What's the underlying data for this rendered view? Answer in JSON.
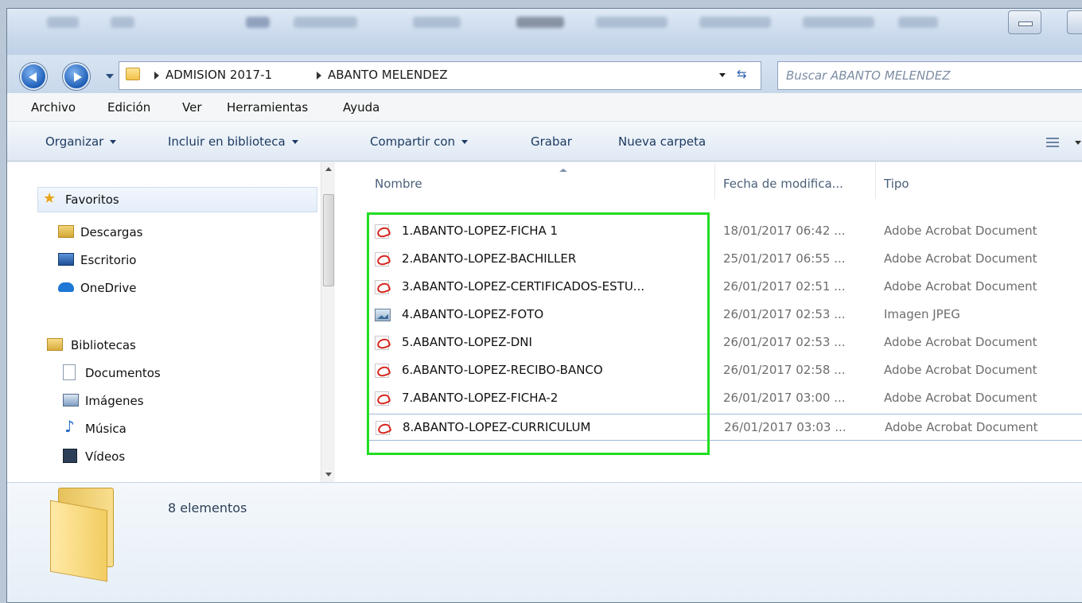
{
  "window": {
    "title_bar_controls": [
      "minimize-icon",
      "maximize-icon"
    ]
  },
  "address": {
    "crumbs": [
      "ADMISION 2017-1",
      "ABANTO MELENDEZ"
    ],
    "search_placeholder": "Buscar ABANTO MELENDEZ"
  },
  "menu": [
    "Archivo",
    "Edición",
    "Ver",
    "Herramientas",
    "Ayuda"
  ],
  "toolbar": {
    "organize": "Organizar",
    "include": "Incluir en biblioteca",
    "share": "Compartir con",
    "burn": "Grabar",
    "new_folder": "Nueva carpeta"
  },
  "sidebar": {
    "favorites": "Favoritos",
    "items": [
      {
        "label": "Descargas",
        "icon": "downloads-icon"
      },
      {
        "label": "Escritorio",
        "icon": "desktop-icon"
      },
      {
        "label": "OneDrive",
        "icon": "onedrive-icon"
      }
    ],
    "libraries": "Bibliotecas",
    "library_items": [
      {
        "label": "Documentos",
        "icon": "documents-icon"
      },
      {
        "label": "Imágenes",
        "icon": "pictures-icon"
      },
      {
        "label": "Música",
        "icon": "music-icon"
      },
      {
        "label": "Vídeos",
        "icon": "videos-icon"
      }
    ]
  },
  "columns": {
    "name": "Nombre",
    "date": "Fecha de modifica...",
    "type": "Tipo"
  },
  "files": [
    {
      "name": "1.ABANTO-LOPEZ-FICHA 1",
      "date": "18/01/2017 06:42 ...",
      "type": "Adobe Acrobat Document",
      "icon": "pdf-icon"
    },
    {
      "name": "2.ABANTO-LOPEZ-BACHILLER",
      "date": "25/01/2017 06:55 ...",
      "type": "Adobe Acrobat Document",
      "icon": "pdf-icon"
    },
    {
      "name": "3.ABANTO-LOPEZ-CERTIFICADOS-ESTU...",
      "date": "26/01/2017 02:51 ...",
      "type": "Adobe Acrobat Document",
      "icon": "pdf-icon"
    },
    {
      "name": "4.ABANTO-LOPEZ-FOTO",
      "date": "26/01/2017 02:53 ...",
      "type": "Imagen JPEG",
      "icon": "jpeg-icon"
    },
    {
      "name": "5.ABANTO-LOPEZ-DNI",
      "date": "26/01/2017 02:53 ...",
      "type": "Adobe Acrobat Document",
      "icon": "pdf-icon"
    },
    {
      "name": "6.ABANTO-LOPEZ-RECIBO-BANCO",
      "date": "26/01/2017 02:58 ...",
      "type": "Adobe Acrobat Document",
      "icon": "pdf-icon"
    },
    {
      "name": "7.ABANTO-LOPEZ-FICHA-2",
      "date": "26/01/2017 03:00 ...",
      "type": "Adobe Acrobat Document",
      "icon": "pdf-icon"
    },
    {
      "name": "8.ABANTO-LOPEZ-CURRICULUM",
      "date": "26/01/2017 03:03 ...",
      "type": "Adobe Acrobat Document",
      "icon": "pdf-icon"
    }
  ],
  "status": {
    "count": "8 elementos"
  },
  "colors": {
    "highlight": "#22dd22",
    "link_text": "#1e3b62"
  }
}
